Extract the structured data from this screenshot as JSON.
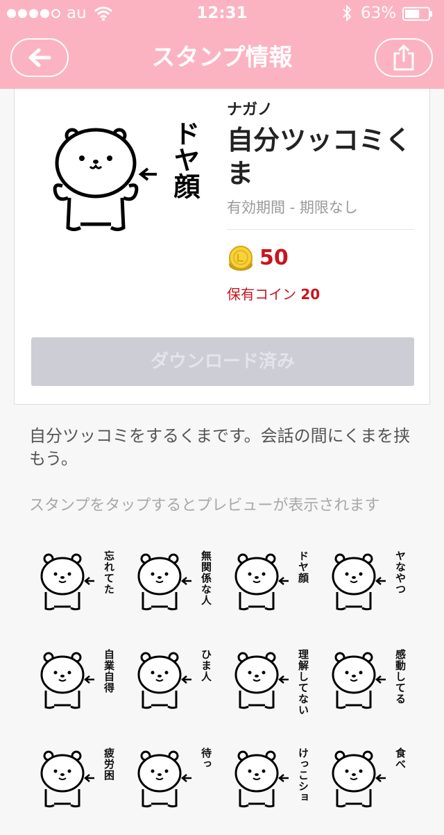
{
  "status_bar": {
    "carrier": "au",
    "time": "12:31",
    "battery": "63%",
    "battery_level": 0.63,
    "signal_bars": 4
  },
  "nav": {
    "title": "スタンプ情報",
    "back_icon": "back-arrow-icon",
    "share_icon": "share-icon"
  },
  "product": {
    "author": "ナガノ",
    "title": "自分ツッコミくま",
    "validity": "有効期間 - 期限なし",
    "price": "50",
    "owned_label": "保有コイン",
    "owned_value": "20",
    "main_sticker_text": "ドヤ顔",
    "download_label": "ダウンロード済み"
  },
  "description": "自分ツッコミをするくまです。会話の間にくまを挟もう。",
  "preview_hint": "スタンプをタップするとプレビューが表示されます",
  "stickers": [
    {
      "text": "忘れてた"
    },
    {
      "text": "無関係な人"
    },
    {
      "text": "ドヤ顔"
    },
    {
      "text": "ヤなやつ"
    },
    {
      "text": "自業自得"
    },
    {
      "text": "ひま人"
    },
    {
      "text": "理解してない"
    },
    {
      "text": "感動してる"
    },
    {
      "text": "疲労困"
    },
    {
      "text": "待っ"
    },
    {
      "text": "けっこショ"
    },
    {
      "text": "食べ"
    }
  ],
  "colors": {
    "header": "#fcb3c1",
    "price": "#c8141e",
    "download_button": "#cccdd5"
  }
}
